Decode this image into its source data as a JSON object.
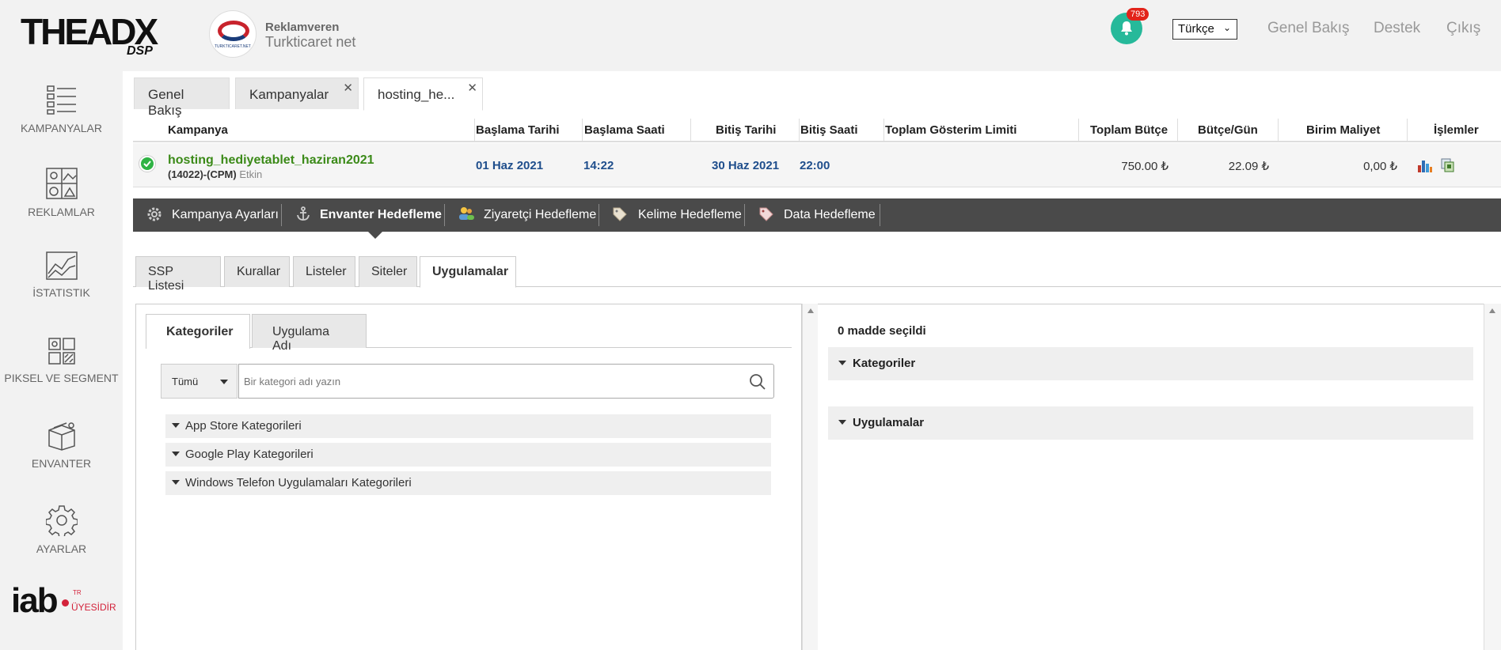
{
  "header": {
    "logo_main": "THEADX",
    "logo_sub": "DSP",
    "advertiser_label": "Reklamveren",
    "advertiser_name": "Turkticaret net",
    "advertiser_logo_text": "TURKTICARET.NET",
    "notification_count": "793",
    "language": "Türkçe",
    "links": [
      "Genel Bakış",
      "Destek",
      "Çıkış"
    ]
  },
  "sidebar": {
    "items": [
      {
        "label": "KAMPANYALAR",
        "icon": "list-icon"
      },
      {
        "label": "REKLAMLAR",
        "icon": "ads-icon"
      },
      {
        "label": "İSTATISTIK",
        "icon": "chart-icon"
      },
      {
        "label": "PIKSEL VE SEGMENT",
        "icon": "segment-icon"
      },
      {
        "label": "ENVANTER",
        "icon": "box-icon"
      },
      {
        "label": "AYARLAR",
        "icon": "gear-icon"
      }
    ],
    "iab": {
      "main": "iab",
      "sub": "ÜYESİDİR",
      "tr": "TR"
    }
  },
  "tabs": [
    {
      "label": "Genel Bakış",
      "closable": false
    },
    {
      "label": "Kampanyalar",
      "closable": true
    },
    {
      "label": "hosting_he...",
      "closable": true,
      "active": true
    }
  ],
  "table": {
    "headers": [
      "Kampanya",
      "Başlama Tarihi",
      "Başlama Saati",
      "Bitiş Tarihi",
      "Bitiş Saati",
      "Toplam Gösterim Limiti",
      "Toplam Bütçe",
      "Bütçe/Gün",
      "Birim Maliyet",
      "İşlemler"
    ],
    "row": {
      "name": "hosting_hediyetablet_haziran2021",
      "id_type": "(14022)-(CPM)",
      "status": "Etkin",
      "start_date": "01 Haz 2021",
      "start_time": "14:22",
      "end_date": "30 Haz 2021",
      "end_time": "22:00",
      "impression_limit": "",
      "total_budget": "750.00 ₺",
      "daily_budget": "22.09 ₺",
      "unit_cost": "0,00 ₺"
    }
  },
  "dark_nav": {
    "items": [
      {
        "label": "Kampanya Ayarları",
        "icon": "gear-icon"
      },
      {
        "label": "Envanter Hedefleme",
        "icon": "anchor-icon",
        "active": true
      },
      {
        "label": "Ziyaretçi Hedefleme",
        "icon": "users-icon"
      },
      {
        "label": "Kelime Hedefleme",
        "icon": "tag-icon"
      },
      {
        "label": "Data Hedefleme",
        "icon": "tag-icon"
      }
    ]
  },
  "sub_tabs": [
    {
      "label": "SSP Listesi"
    },
    {
      "label": "Kurallar"
    },
    {
      "label": "Listeler"
    },
    {
      "label": "Siteler"
    },
    {
      "label": "Uygulamalar",
      "active": true
    }
  ],
  "left_panel": {
    "tabs": [
      {
        "label": "Kategoriler",
        "active": true
      },
      {
        "label": "Uygulama Adı"
      }
    ],
    "filter_value": "Tümü",
    "search_placeholder": "Bir kategori adı yazın",
    "categories": [
      "App Store Kategorileri",
      "Google Play Kategorileri",
      "Windows Telefon Uygulamaları Kategorileri"
    ]
  },
  "right_panel": {
    "selected_count": "0 madde seçildi",
    "sections": [
      "Kategoriler",
      "Uygulamalar"
    ]
  },
  "colors": {
    "accent_green": "#26b99a",
    "badge_red": "#e2231a",
    "campaign_green": "#3b8a18",
    "date_blue": "#1f4e8c",
    "dark_bar": "#4a4a4a"
  }
}
